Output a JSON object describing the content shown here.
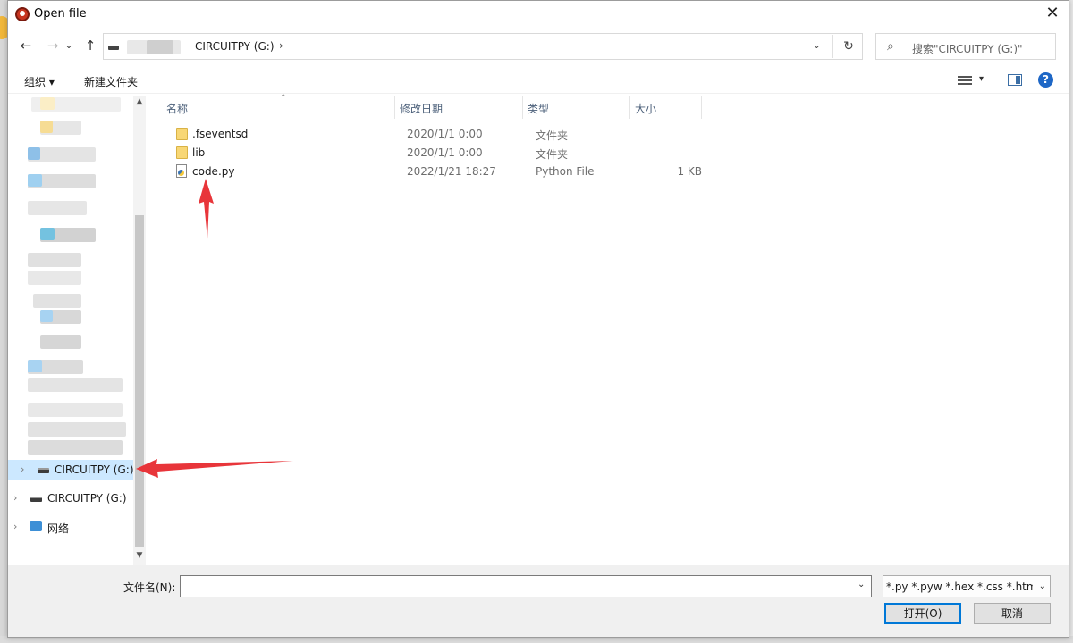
{
  "window": {
    "title": "Open file",
    "close_symbol": "✕"
  },
  "nav": {
    "back": "←",
    "forward": "→",
    "recent": "⌄",
    "up": "↑"
  },
  "address": {
    "location": "CIRCUITPY (G:)",
    "chevron": "›",
    "dropdown": "⌄",
    "refresh": "↻"
  },
  "search": {
    "placeholder": "搜索\"CIRCUITPY (G:)\"",
    "icon": "⌕"
  },
  "toolbar": {
    "organize": "组织 ▾",
    "new_folder": "新建文件夹",
    "view_dropdown": "▾",
    "help": "?"
  },
  "sidebar": {
    "items": [
      {
        "label": "CIRCUITPY (G:)",
        "icon": "drive-icon",
        "selected": true
      },
      {
        "label": "CIRCUITPY (G:)",
        "icon": "drive-icon",
        "selected": false
      },
      {
        "label": "网络",
        "icon": "network-icon",
        "selected": false
      }
    ],
    "chevron": "›",
    "scroll_up": "▲",
    "scroll_down": "▼"
  },
  "columns": {
    "name": "名称",
    "date": "修改日期",
    "type": "类型",
    "size": "大小",
    "sort_indicator": "^"
  },
  "files": [
    {
      "name": ".fseventsd",
      "date": "2020/1/1 0:00",
      "type": "文件夹",
      "size": "",
      "icon": "folder-icon"
    },
    {
      "name": "lib",
      "date": "2020/1/1 0:00",
      "type": "文件夹",
      "size": "",
      "icon": "folder-icon"
    },
    {
      "name": "code.py",
      "date": "2022/1/21 18:27",
      "type": "Python File",
      "size": "1 KB",
      "icon": "python-file-icon"
    }
  ],
  "bottom": {
    "filename_label": "文件名(N):",
    "filename_value": "",
    "filename_dropdown": "⌄",
    "filetype_value": "*.py *.pyw *.hex *.css *.html *",
    "filetype_dropdown": "⌄",
    "open_button": "打开(O)",
    "cancel_button": "取消"
  },
  "colors": {
    "annotation_arrow": "#e8353a",
    "selection": "#cce8ff",
    "primary_border": "#0078d7"
  }
}
